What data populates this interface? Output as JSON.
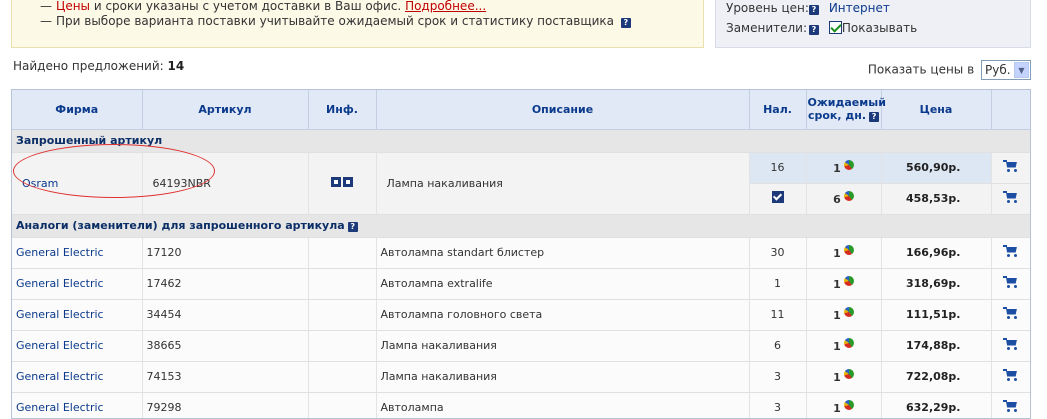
{
  "notice": {
    "line1_red": "Цены",
    "line1_text": " и сроки указаны с учетом доставки в Ваш офис.",
    "line1_link": "Подробнее...",
    "line2_text": "При выборе варианта поставки учитывайте ожидаемый срок и статистику поставщика",
    "help_glyph": "?"
  },
  "settings": {
    "price_level_label": "Уровень цен:",
    "price_level_value": "Интернет",
    "substitutes_label": "Заменители:",
    "substitutes_check_label": "Показывать",
    "substitutes_checked": true
  },
  "found": {
    "label": "Найдено предложений:",
    "count": "14"
  },
  "currency": {
    "label": "Показать цены в",
    "value": "Руб."
  },
  "table": {
    "headers": {
      "firm": "Фирма",
      "article": "Артикул",
      "info": "Инф.",
      "description": "Описание",
      "stock": "Нал.",
      "eta_line1": "Ожидаемый",
      "eta_line2": "срок, дн.",
      "price": "Цена"
    },
    "requested_section": "Запрошенный артикул",
    "requested": {
      "firm": "Osram",
      "article": "64193NBR",
      "description": "Лампа накаливания",
      "offers": [
        {
          "stock": "16",
          "eta": "1",
          "price": "560,90р."
        },
        {
          "stock": "",
          "eta": "6",
          "price": "458,53р."
        }
      ]
    },
    "analogs_section": "Аналоги (заменители) для запрошенного артикула",
    "analogs": [
      {
        "firm": "General Electric",
        "article": "17120",
        "description": "Автолампа standart блистер",
        "stock": "30",
        "eta": "1",
        "price": "166,96р."
      },
      {
        "firm": "General Electric",
        "article": "17462",
        "description": "Автолампа extralife",
        "stock": "1",
        "eta": "1",
        "price": "318,69р."
      },
      {
        "firm": "General Electric",
        "article": "34454",
        "description": "Автолампа головного света",
        "stock": "11",
        "eta": "1",
        "price": "111,51р."
      },
      {
        "firm": "General Electric",
        "article": "38665",
        "description": "Лампа накаливания",
        "stock": "6",
        "eta": "1",
        "price": "174,88р."
      },
      {
        "firm": "General Electric",
        "article": "74153",
        "description": "Лампа накаливания",
        "stock": "3",
        "eta": "1",
        "price": "722,08р."
      },
      {
        "firm": "General Electric",
        "article": "79298",
        "description": "Автолампа",
        "stock": "3",
        "eta": "1",
        "price": "632,29р."
      }
    ]
  }
}
